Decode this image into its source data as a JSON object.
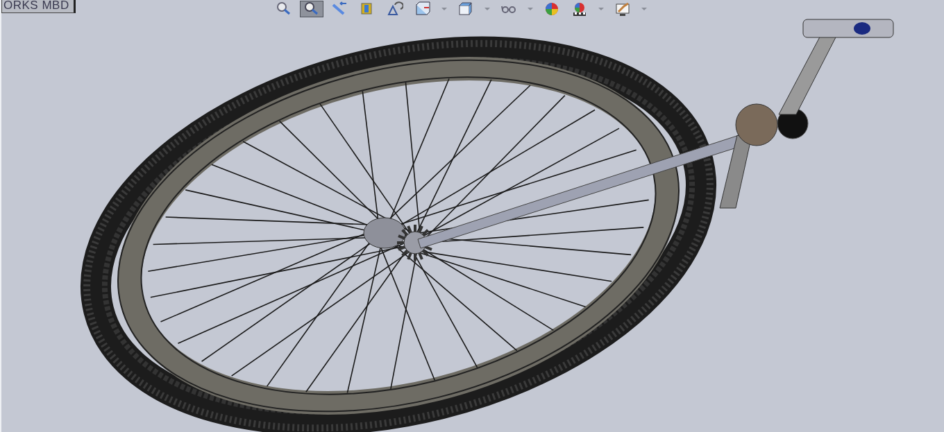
{
  "tab": {
    "label": "ORKS MBD"
  },
  "toolbar": [
    {
      "kind": "zoom-fit",
      "selected": false,
      "dropdown": false
    },
    {
      "kind": "zoom-area",
      "selected": true,
      "dropdown": false
    },
    {
      "kind": "previous-view",
      "selected": false,
      "dropdown": false
    },
    {
      "kind": "section",
      "selected": false,
      "dropdown": false
    },
    {
      "kind": "annotation",
      "selected": false,
      "dropdown": false
    },
    {
      "kind": "orientation",
      "selected": false,
      "dropdown": true
    },
    {
      "kind": "display-style",
      "selected": false,
      "dropdown": true
    },
    {
      "kind": "hide-show",
      "selected": false,
      "dropdown": true
    },
    {
      "kind": "appearance",
      "selected": false,
      "dropdown": false
    },
    {
      "kind": "scene",
      "selected": false,
      "dropdown": true
    },
    {
      "kind": "view-settings",
      "selected": false,
      "dropdown": true
    }
  ]
}
